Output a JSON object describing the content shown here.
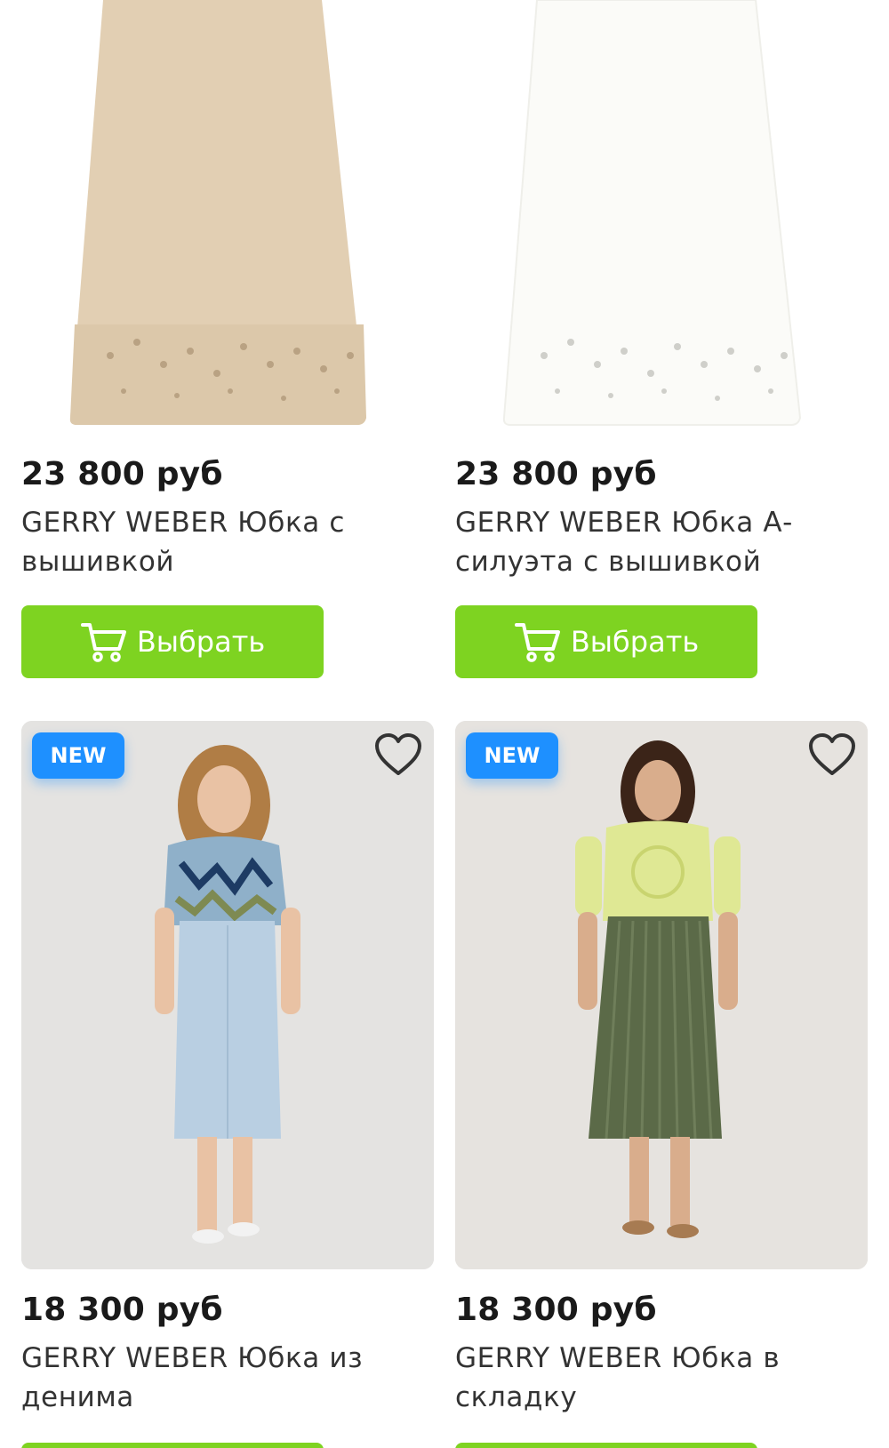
{
  "colors": {
    "accent": "#7ed321",
    "badge": "#1e90ff"
  },
  "products": [
    {
      "price": "23 800 руб",
      "title": "GERRY WEBER Юбка с вышивкой",
      "button": "Выбрать",
      "skirt_color": "#e2cfb3"
    },
    {
      "price": "23 800 руб",
      "title": "GERRY WEBER Юбка А-силуэта с вышивкой",
      "button": "Выбрать",
      "skirt_color": "#fbfbf8"
    },
    {
      "price": "18 300 руб",
      "title": "GERRY WEBER Юбка из денима",
      "badge": "NEW",
      "favorite_icon": "heart-outline-icon"
    },
    {
      "price": "18 300 руб",
      "title": "GERRY WEBER Юбка в складку",
      "badge": "NEW",
      "favorite_icon": "heart-outline-icon"
    }
  ]
}
